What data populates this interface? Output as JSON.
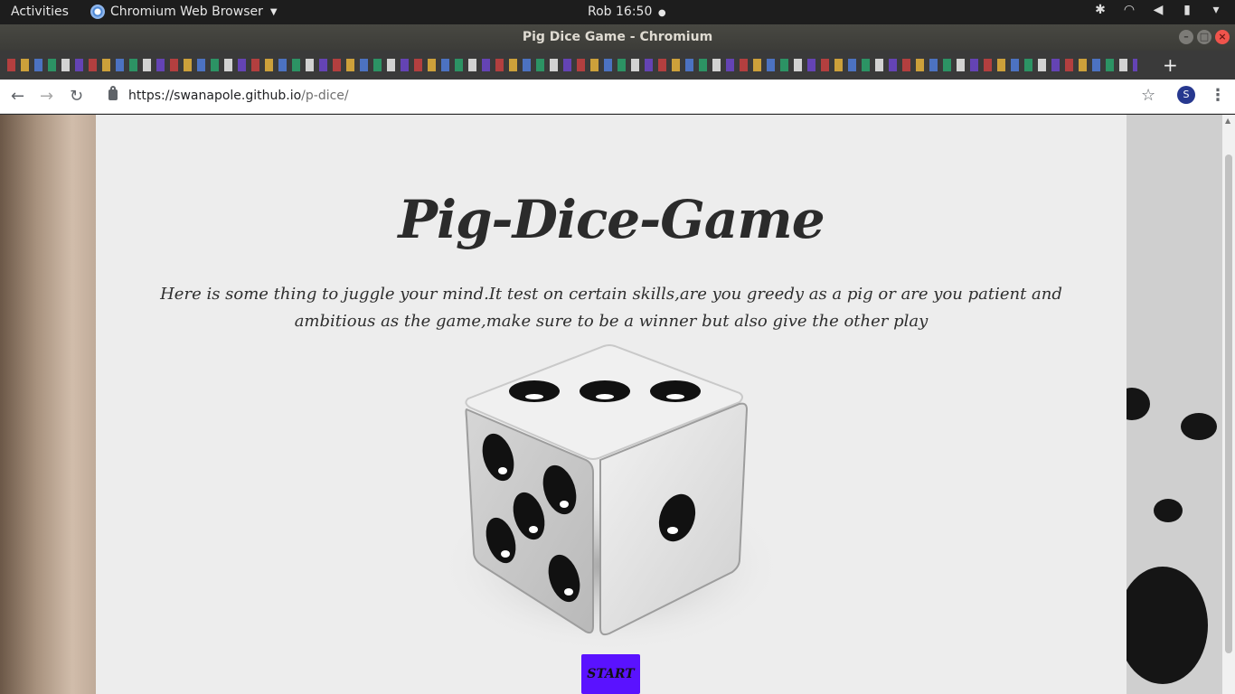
{
  "system_bar": {
    "activities": "Activities",
    "app_name": "Chromium Web Browser",
    "clock": "Rob 16:50",
    "clock_indicator": "●"
  },
  "window": {
    "title": "Pig Dice Game - Chromium"
  },
  "tabs": {
    "new_tab": "+"
  },
  "toolbar": {
    "url_host": "https://swanapole.github.io",
    "url_path": "/p-dice/",
    "profile_initial": "S"
  },
  "page": {
    "title": "Pig-Dice-Game",
    "intro": "Here is some thing to juggle your mind.It test on certain skills,are you greedy as a pig or are you patient and ambitious as the game,make sure to be a winner but also give the other play",
    "start_button": "START"
  },
  "colors": {
    "start_button": "#5a12ff",
    "page_background": "#ededed"
  }
}
